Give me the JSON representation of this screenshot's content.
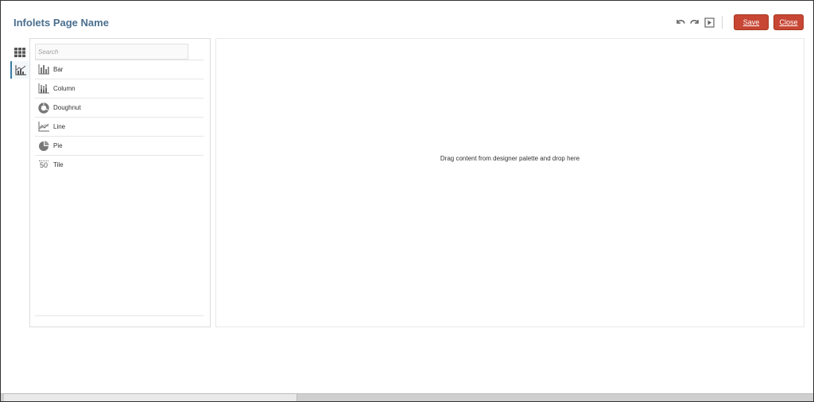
{
  "header": {
    "title": "Infolets Page Name",
    "save_label": "Save",
    "close_label": "Close"
  },
  "toolbar_icons": [
    "undo-icon",
    "redo-icon",
    "preview-play-icon"
  ],
  "side_tabs": [
    {
      "icon": "grid-icon",
      "active": false
    },
    {
      "icon": "chart-icon",
      "active": true
    }
  ],
  "palette": {
    "search_placeholder": "Search",
    "items": [
      {
        "label": "Bar",
        "icon": "bar-chart-icon"
      },
      {
        "label": "Column",
        "icon": "column-chart-icon"
      },
      {
        "label": "Doughnut",
        "icon": "doughnut-chart-icon"
      },
      {
        "label": "Line",
        "icon": "line-chart-icon"
      },
      {
        "label": "Pie",
        "icon": "pie-chart-icon"
      },
      {
        "label": "Tile",
        "icon": "tile-icon",
        "icon_text": "50"
      }
    ]
  },
  "canvas": {
    "drop_message": "Drag content from designer palette and drop here"
  },
  "colors": {
    "accent": "#c74634",
    "title": "#4a6f8f",
    "active_tab": "#3a7ca5"
  }
}
